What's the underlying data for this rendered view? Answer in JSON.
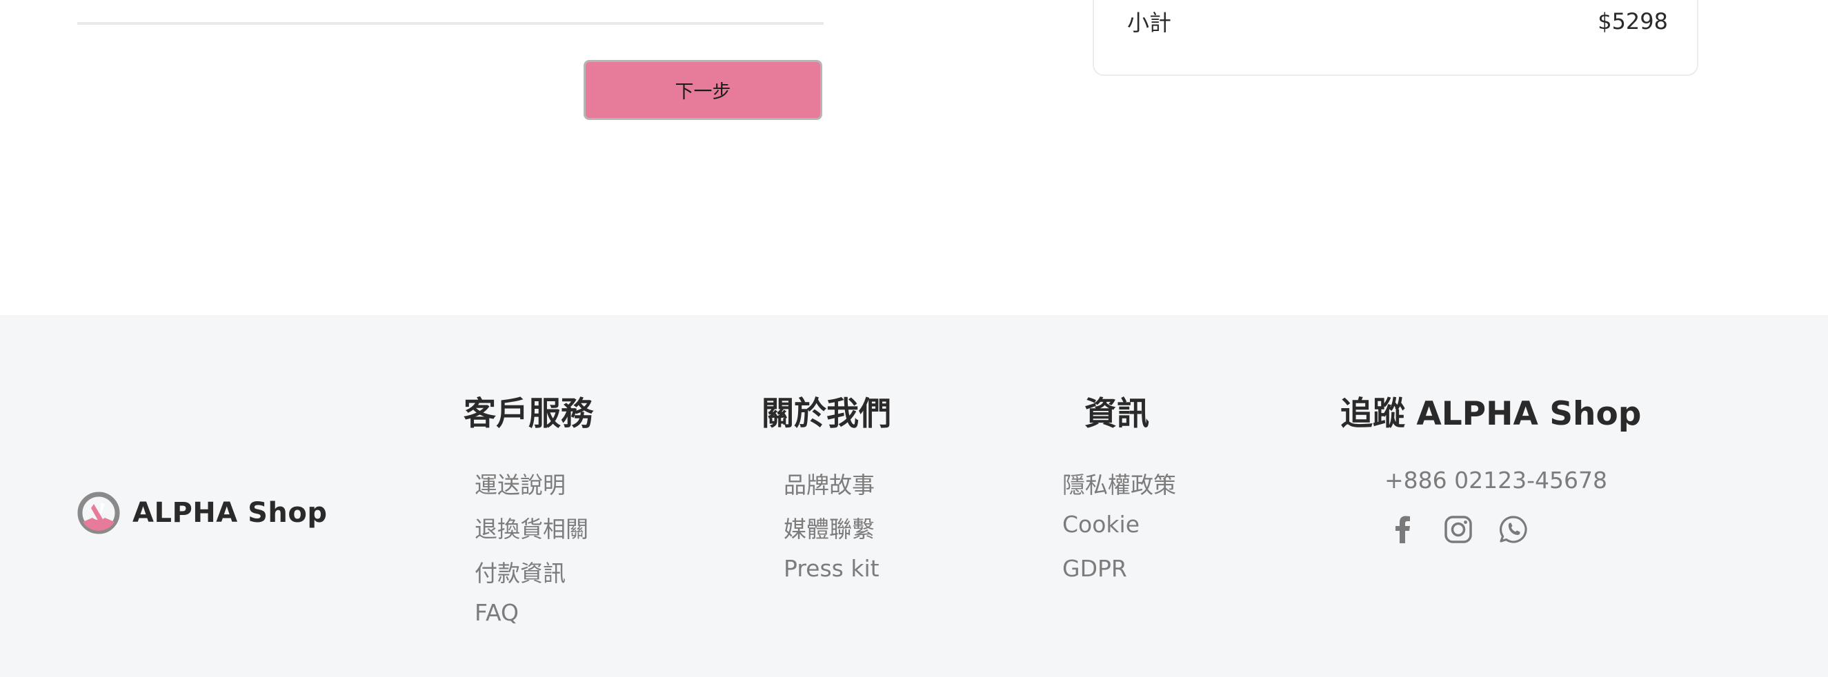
{
  "form": {
    "next_button": "下一步"
  },
  "summary": {
    "subtotal_label": "小計",
    "subtotal_value": "$5298"
  },
  "footer": {
    "brand": "ALPHA Shop",
    "columns": [
      {
        "title": "客戶服務",
        "links": [
          "運送說明",
          "退換貨相關",
          "付款資訊",
          "FAQ"
        ]
      },
      {
        "title": "關於我們",
        "links": [
          "品牌故事",
          "媒體聯繫",
          "Press kit"
        ]
      },
      {
        "title": "資訊",
        "links": [
          "隱私權政策",
          "Cookie",
          "GDPR"
        ]
      }
    ],
    "follow": {
      "title": "追蹤 ALPHA Shop",
      "phone": "+886 02123-45678",
      "icons": [
        "facebook-icon",
        "instagram-icon",
        "whatsapp-icon"
      ]
    }
  },
  "colors": {
    "accent": "#e67b9a",
    "footer_bg": "#f5f6f8",
    "link_gray": "#7c7c7c"
  }
}
